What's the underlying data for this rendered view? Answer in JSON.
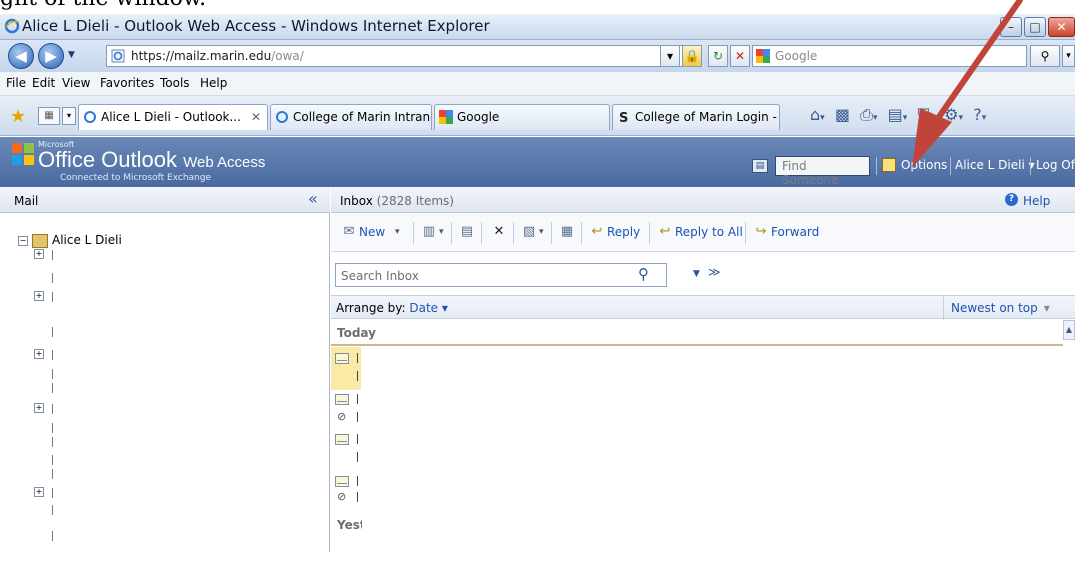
{
  "caption": "ght of the window.",
  "window": {
    "title": "Alice L Dieli - Outlook Web Access - Windows Internet Explorer"
  },
  "address": {
    "url_host": "https://mailz.marin.edu",
    "url_path": "/owa/",
    "search_placeholder": "Google"
  },
  "menu": [
    "File",
    "Edit",
    "View",
    "Favorites",
    "Tools",
    "Help"
  ],
  "tabs": [
    {
      "label": "Alice L Dieli - Outlook...",
      "active": true
    },
    {
      "label": "College of Marin Intranet",
      "active": false
    },
    {
      "label": "Google",
      "active": false
    },
    {
      "label": "College of Marin Login - ...",
      "active": false
    }
  ],
  "owa": {
    "ms_label": "Microsoft",
    "brand": "Office Outlook",
    "brand_suffix": "Web Access",
    "subtitle": "Connected to Microsoft Exchange",
    "find_someone": "Find Someone",
    "options": "Options",
    "user": "Alice L Dieli",
    "logoff": "Log Off"
  },
  "nav": {
    "header": "Mail",
    "collapse": "«",
    "root": "Alice L Dieli"
  },
  "inbox": {
    "title": "Inbox",
    "count": "(2828 Items)",
    "help": "Help",
    "toolbar": {
      "new": "New",
      "reply": "Reply",
      "reply_all": "Reply to All",
      "forward": "Forward"
    },
    "search_placeholder": "Search Inbox",
    "arrange_label": "Arrange by:",
    "arrange_value": "Date",
    "sort_order": "Newest on top",
    "group_today": "Today",
    "group_yesterday": "Yest"
  },
  "colors": {
    "arrow": "#c0443a",
    "owa_header": "#5a78ab",
    "link": "#1d53b3",
    "selected_row": "#fbe9a6"
  }
}
